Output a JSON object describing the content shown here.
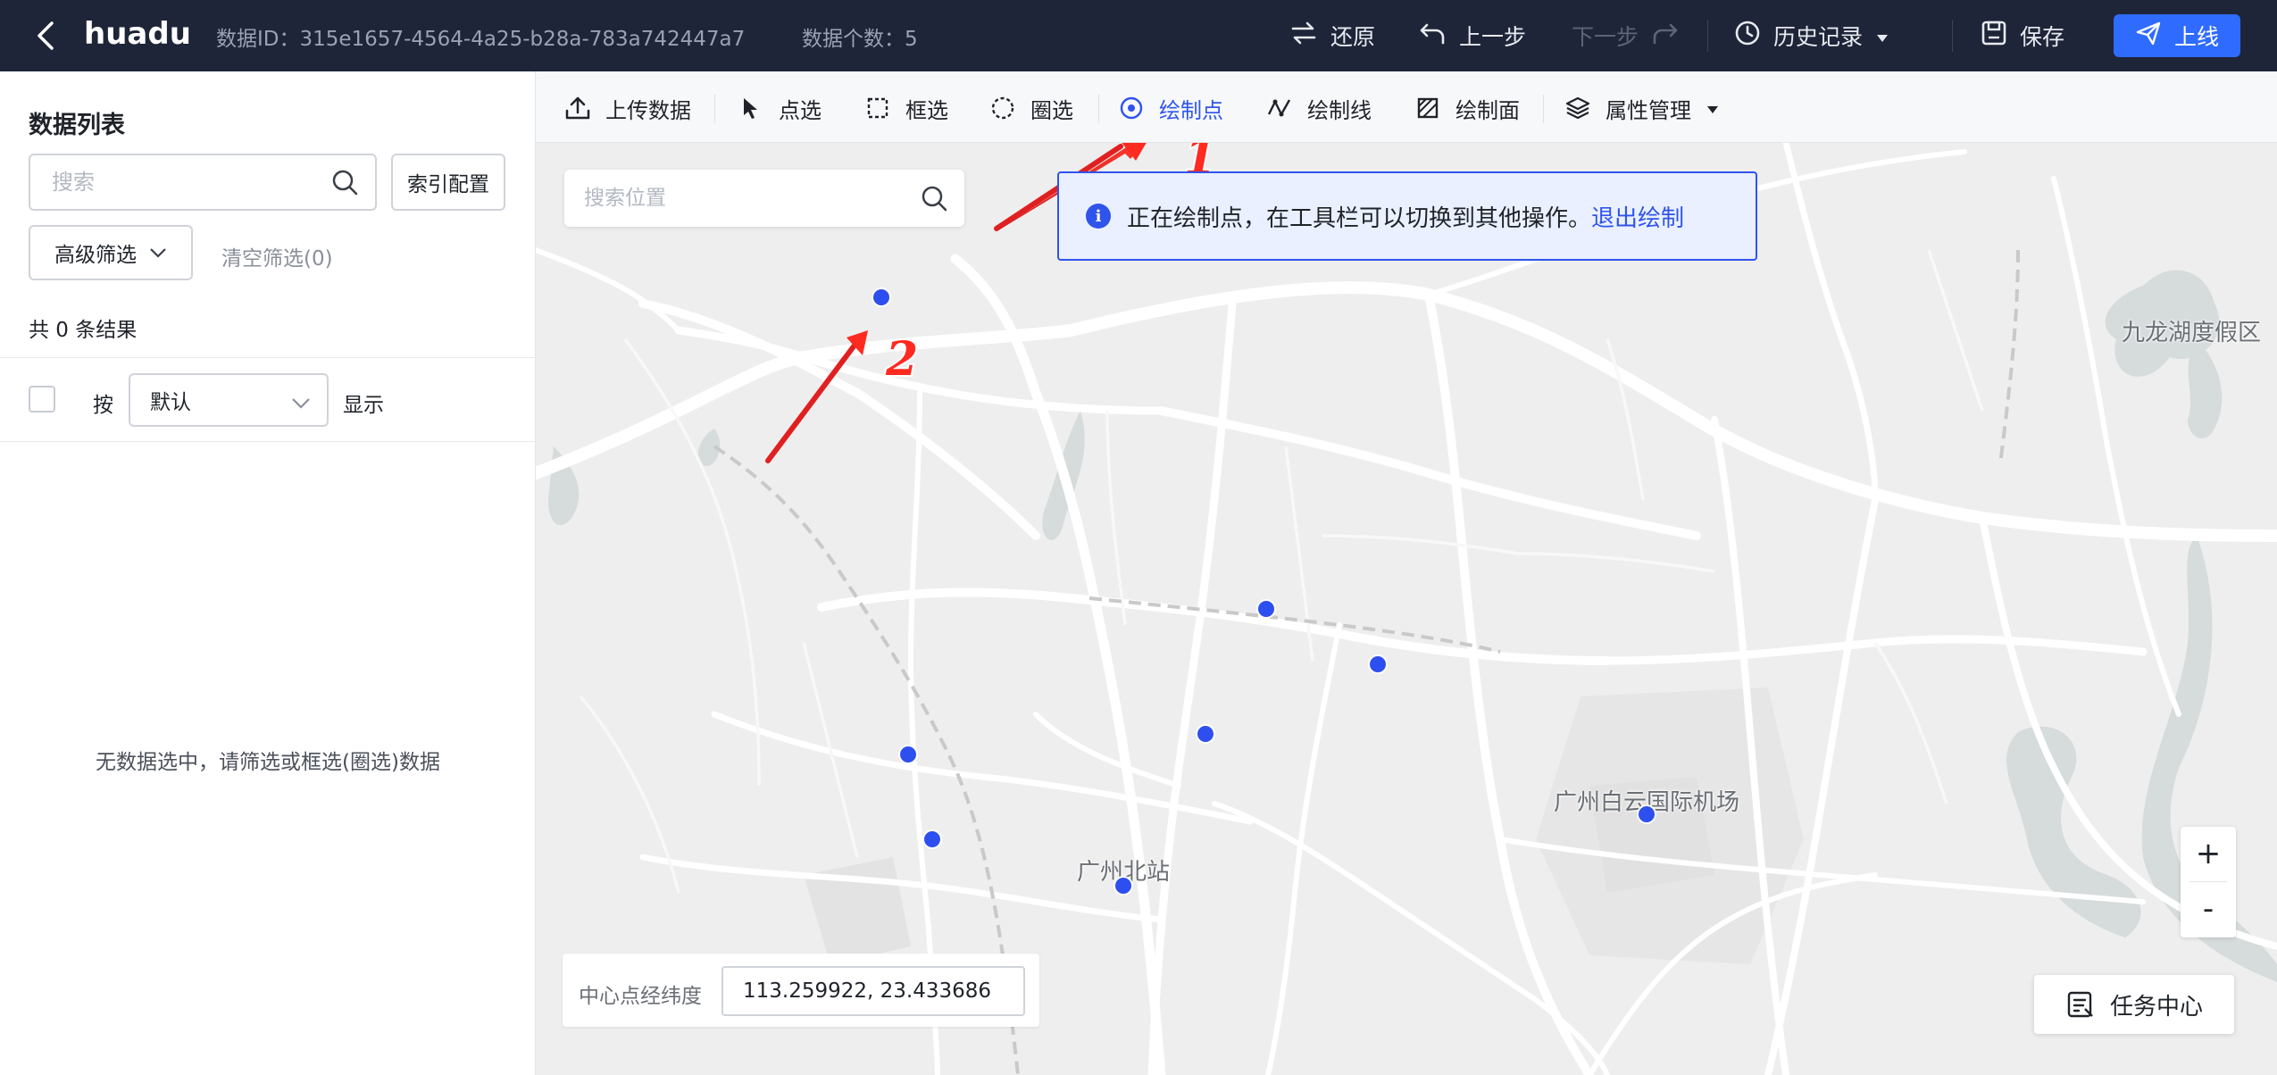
{
  "header": {
    "app_name": "huadu",
    "data_id": "数据ID：315e1657-4564-4a25-b28a-783a742447a7",
    "data_count": "数据个数：5",
    "restore_label": "还原",
    "undo_label": "上一步",
    "redo_label": "下一步",
    "history_label": "历史记录",
    "save_label": "保存",
    "publish_label": "上线"
  },
  "sidebar": {
    "title": "数据列表",
    "search_placeholder": "搜索",
    "index_config_label": "索引配置",
    "advanced_filter_label": "高级筛选",
    "clear_filter_label": "清空筛选(0)",
    "result_count": "共 0 条结果",
    "sort_prefix": "按",
    "sort_value": "默认",
    "sort_suffix": "显示",
    "empty_message": "无数据选中，请筛选或框选(圈选)数据"
  },
  "toolbar": {
    "upload": "上传数据",
    "point_select": "点选",
    "box_select": "框选",
    "circle_select": "圈选",
    "draw_point": "绘制点",
    "draw_line": "绘制线",
    "draw_polygon": "绘制面",
    "attribute_mgmt": "属性管理",
    "active_tool": "draw_point"
  },
  "map": {
    "location_search_placeholder": "搜索位置",
    "notice_text": "正在绘制点，在工具栏可以切换到其他操作。",
    "notice_link": "退出绘制",
    "labels": {
      "jiulong": "九龙湖度假区",
      "airport": "广州白云国际机场",
      "north_station": "广州北站"
    },
    "zoom_in": "+",
    "zoom_out": "-",
    "center_label": "中心点经纬度",
    "center_value": "113.259922, 23.433686",
    "task_center": "任务中心",
    "annotation_1": "1",
    "annotation_2": "2",
    "point_color": "#2e4ff0",
    "accent_color": "#2f54eb"
  }
}
